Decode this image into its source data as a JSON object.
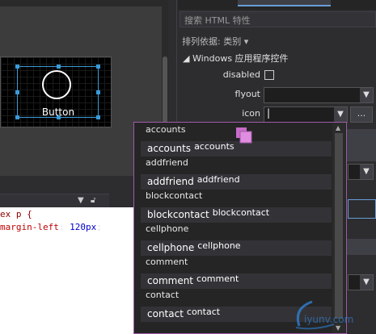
{
  "designer": {
    "button_label": "Button"
  },
  "css_pane": {
    "code_lines": [
      "ex p {",
      "margin-left: 120px;"
    ]
  },
  "properties": {
    "search_placeholder": "搜索 HTML 特性",
    "sort_label": "排列依据: 类别 ▾",
    "group_label": "◢ Windows 应用程序控件",
    "disabled_label": "disabled",
    "flyout_label": "flyout",
    "icon_label": "icon",
    "icon_value": "|",
    "more_button": "..."
  },
  "dropdown": {
    "items": [
      {
        "name": "accounts",
        "row_text": "accounts",
        "row_sub": "accounts"
      },
      {
        "name": "addfriend",
        "row_text": "addfriend",
        "row_sub": "addfriend"
      },
      {
        "name": "blockcontact",
        "row_text": "blockcontact",
        "row_sub": "blockcontact"
      },
      {
        "name": "cellphone",
        "row_text": "cellphone",
        "row_sub": "cellphone"
      },
      {
        "name": "comment",
        "row_text": "comment",
        "row_sub": "comment"
      },
      {
        "name": "contact",
        "row_text": "contact",
        "row_sub": "contact"
      }
    ]
  },
  "colors": {
    "accent": "#3a9ad9",
    "dropdown_border": "#a05ba8",
    "code_selector": "#8b0000",
    "code_property": "#c00000",
    "code_value": "#0000cc"
  }
}
